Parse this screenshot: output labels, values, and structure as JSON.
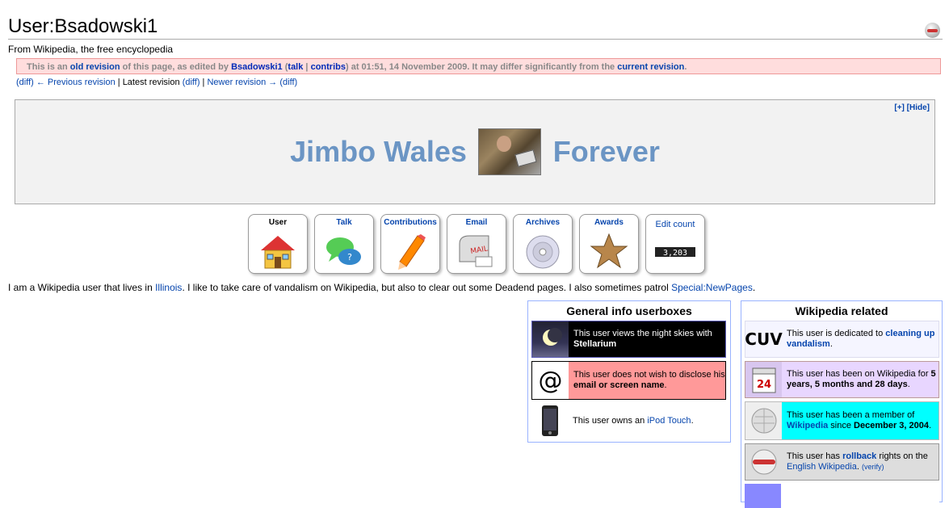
{
  "page": {
    "title": "User:Bsadowski1",
    "tagline": "From Wikipedia, the free encyclopedia"
  },
  "old_revision": {
    "t1": "This is an ",
    "old_revision_link": "old revision",
    "t2": " of this page, as edited by ",
    "user_link": "Bsadowski1",
    "t3": " (",
    "talk_link": "talk",
    "sep": " | ",
    "contribs_link": "contribs",
    "t4": ") at 01:51, 14 November 2009. It may differ significantly from the ",
    "current_link": "current revision",
    "t5": "."
  },
  "revision_nav": {
    "diff1": "(diff)",
    "previous": "← Previous revision",
    "sep1": " | ",
    "latest_label": "Latest revision",
    "diff2": "(diff)",
    "sep2": " | ",
    "newer": "Newer revision →",
    "diff3": "(diff)"
  },
  "banner": {
    "left_text": "Jimbo Wales",
    "right_text": "Forever",
    "expand": "[+]",
    "hide": "[Hide]"
  },
  "tabs": [
    {
      "label": "User",
      "icon": "house-icon"
    },
    {
      "label": "Talk",
      "icon": "speech-bubbles-icon"
    },
    {
      "label": "Contributions",
      "icon": "pencil-icon"
    },
    {
      "label": "Email",
      "icon": "mailbox-icon"
    },
    {
      "label": "Archives",
      "icon": "disc-icon"
    },
    {
      "label": "Awards",
      "icon": "barnstar-icon"
    },
    {
      "label": "Edit count",
      "icon": "counter-icon",
      "counter": "3,203"
    }
  ],
  "intro": {
    "t1": "I am a Wikipedia user that lives in ",
    "illinois": "Illinois",
    "t2": ". I like to take care of vandalism on Wikipedia, but also to clear out some Deadend pages. I also sometimes patrol ",
    "newpages": "Special:NewPages",
    "t3": "."
  },
  "general_panel": {
    "title": "General info userboxes",
    "boxes": [
      {
        "t1": "This user views the night skies with ",
        "bold": "Stellarium",
        "t2": ""
      },
      {
        "t1": "This user does not wish to disclose his ",
        "bold": "email or screen name",
        "t2": "."
      },
      {
        "t1": "This user owns an ",
        "link": "iPod Touch",
        "t2": "."
      }
    ]
  },
  "wiki_panel": {
    "title": "Wikipedia related",
    "boxes": [
      {
        "icon_text": "CUV",
        "t1": "This user is dedicated to ",
        "link": "cleaning up vandalism",
        "t2": "."
      },
      {
        "calendar_day": "24",
        "t1": "This user has been on Wikipedia for ",
        "bold": "5 years, 5 months and 28 days",
        "t2": "."
      },
      {
        "t1": "This user has been a member of ",
        "link": "Wikipedia",
        "t2": " since ",
        "bold": "December 3, 2004",
        "t3": "."
      },
      {
        "t1": "This user has ",
        "link": "rollback",
        "t2": " rights on the ",
        "link2": "English Wikipedia",
        "t3": ". ",
        "small": "(verify)"
      }
    ]
  },
  "colors": {
    "link": "#0645ad",
    "banner_text": "#6b95c4",
    "old_revision_bg": "#ffdddd",
    "stellarium_bg": "#000000",
    "email_bg": "#ff9999",
    "cuv_bg": "#f5f5ff",
    "tenure_bg": "#e8d6ff",
    "member_bg": "#00ffff",
    "rollback_bg": "#dddddd"
  }
}
